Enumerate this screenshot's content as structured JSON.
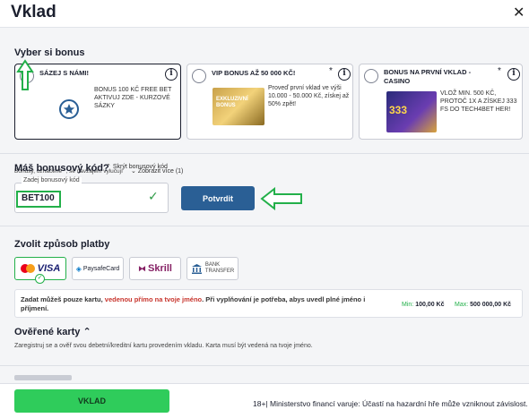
{
  "header": {
    "title": "Vklad"
  },
  "bonus": {
    "section_title": "Vyber si bonus",
    "cards": [
      {
        "title": "SÁZEJ S NÁMI!",
        "text": "BONUS 100 KČ FREE BET AKTIVUJ ZDE - KURZOVÉ SÁZKY",
        "selected": true
      },
      {
        "title": "VIP BONUS AŽ 50 000 KČ!",
        "text": "Proveď první vklad ve výši 10.000 - 50.000 Kč, získej až 50% zpět!",
        "badge": "EXKLUZIVNÍ BONUS",
        "star": "*"
      },
      {
        "title": "BONUS NA PRVNÍ VKLAD - CASINO",
        "text": "VLOŽ MIN. 500 KČ, PROTOČ 1X A ZÍSKEJ 333 FS DO TECH4BET HER!",
        "badge": "333",
        "star": "*"
      }
    ],
    "note": "Bonusy, označené *, se navzájem vylučují",
    "show_more": "Zobrazit více (1)"
  },
  "bonus_code": {
    "title": "Máš bonusový kód?",
    "hide": "Skrýt bonusový kód",
    "label": "Zadej bonusový kód",
    "value": "BET100",
    "confirm": "Potvrdit"
  },
  "payment": {
    "title": "Zvolit způsob platby",
    "methods": [
      {
        "name": "VISA"
      },
      {
        "name": "PaysafeCard"
      },
      {
        "name": "Skrill"
      },
      {
        "name": "BANK",
        "sub": "TRANSFER"
      }
    ],
    "info_part1": "Zadat můžeš pouze kartu, ",
    "info_red": "vedenou přímo na tvoje jméno",
    "info_part2": ". Při vyplňování je potřeba, abys uvedl plné jméno i příjmení.",
    "min_label": "Min:",
    "min_value": "100,00 Kč",
    "max_label": "Max:",
    "max_value": "500 000,00 Kč"
  },
  "verified": {
    "title": "Ověřené karty",
    "desc": "Zaregistruj se a ověř svou debetní/kreditní kartu provedením vkladu. Karta musí být vedená na tvoje jméno."
  },
  "footer": {
    "button": "VKLAD",
    "warning": "18+| Ministerstvo financí varuje: Účastí na hazardní hře může vzniknout závislost."
  },
  "colors": {
    "primary": "#2a5f95",
    "green": "#2fcc5b",
    "highlight": "#23b04a",
    "red": "#c8352d"
  }
}
